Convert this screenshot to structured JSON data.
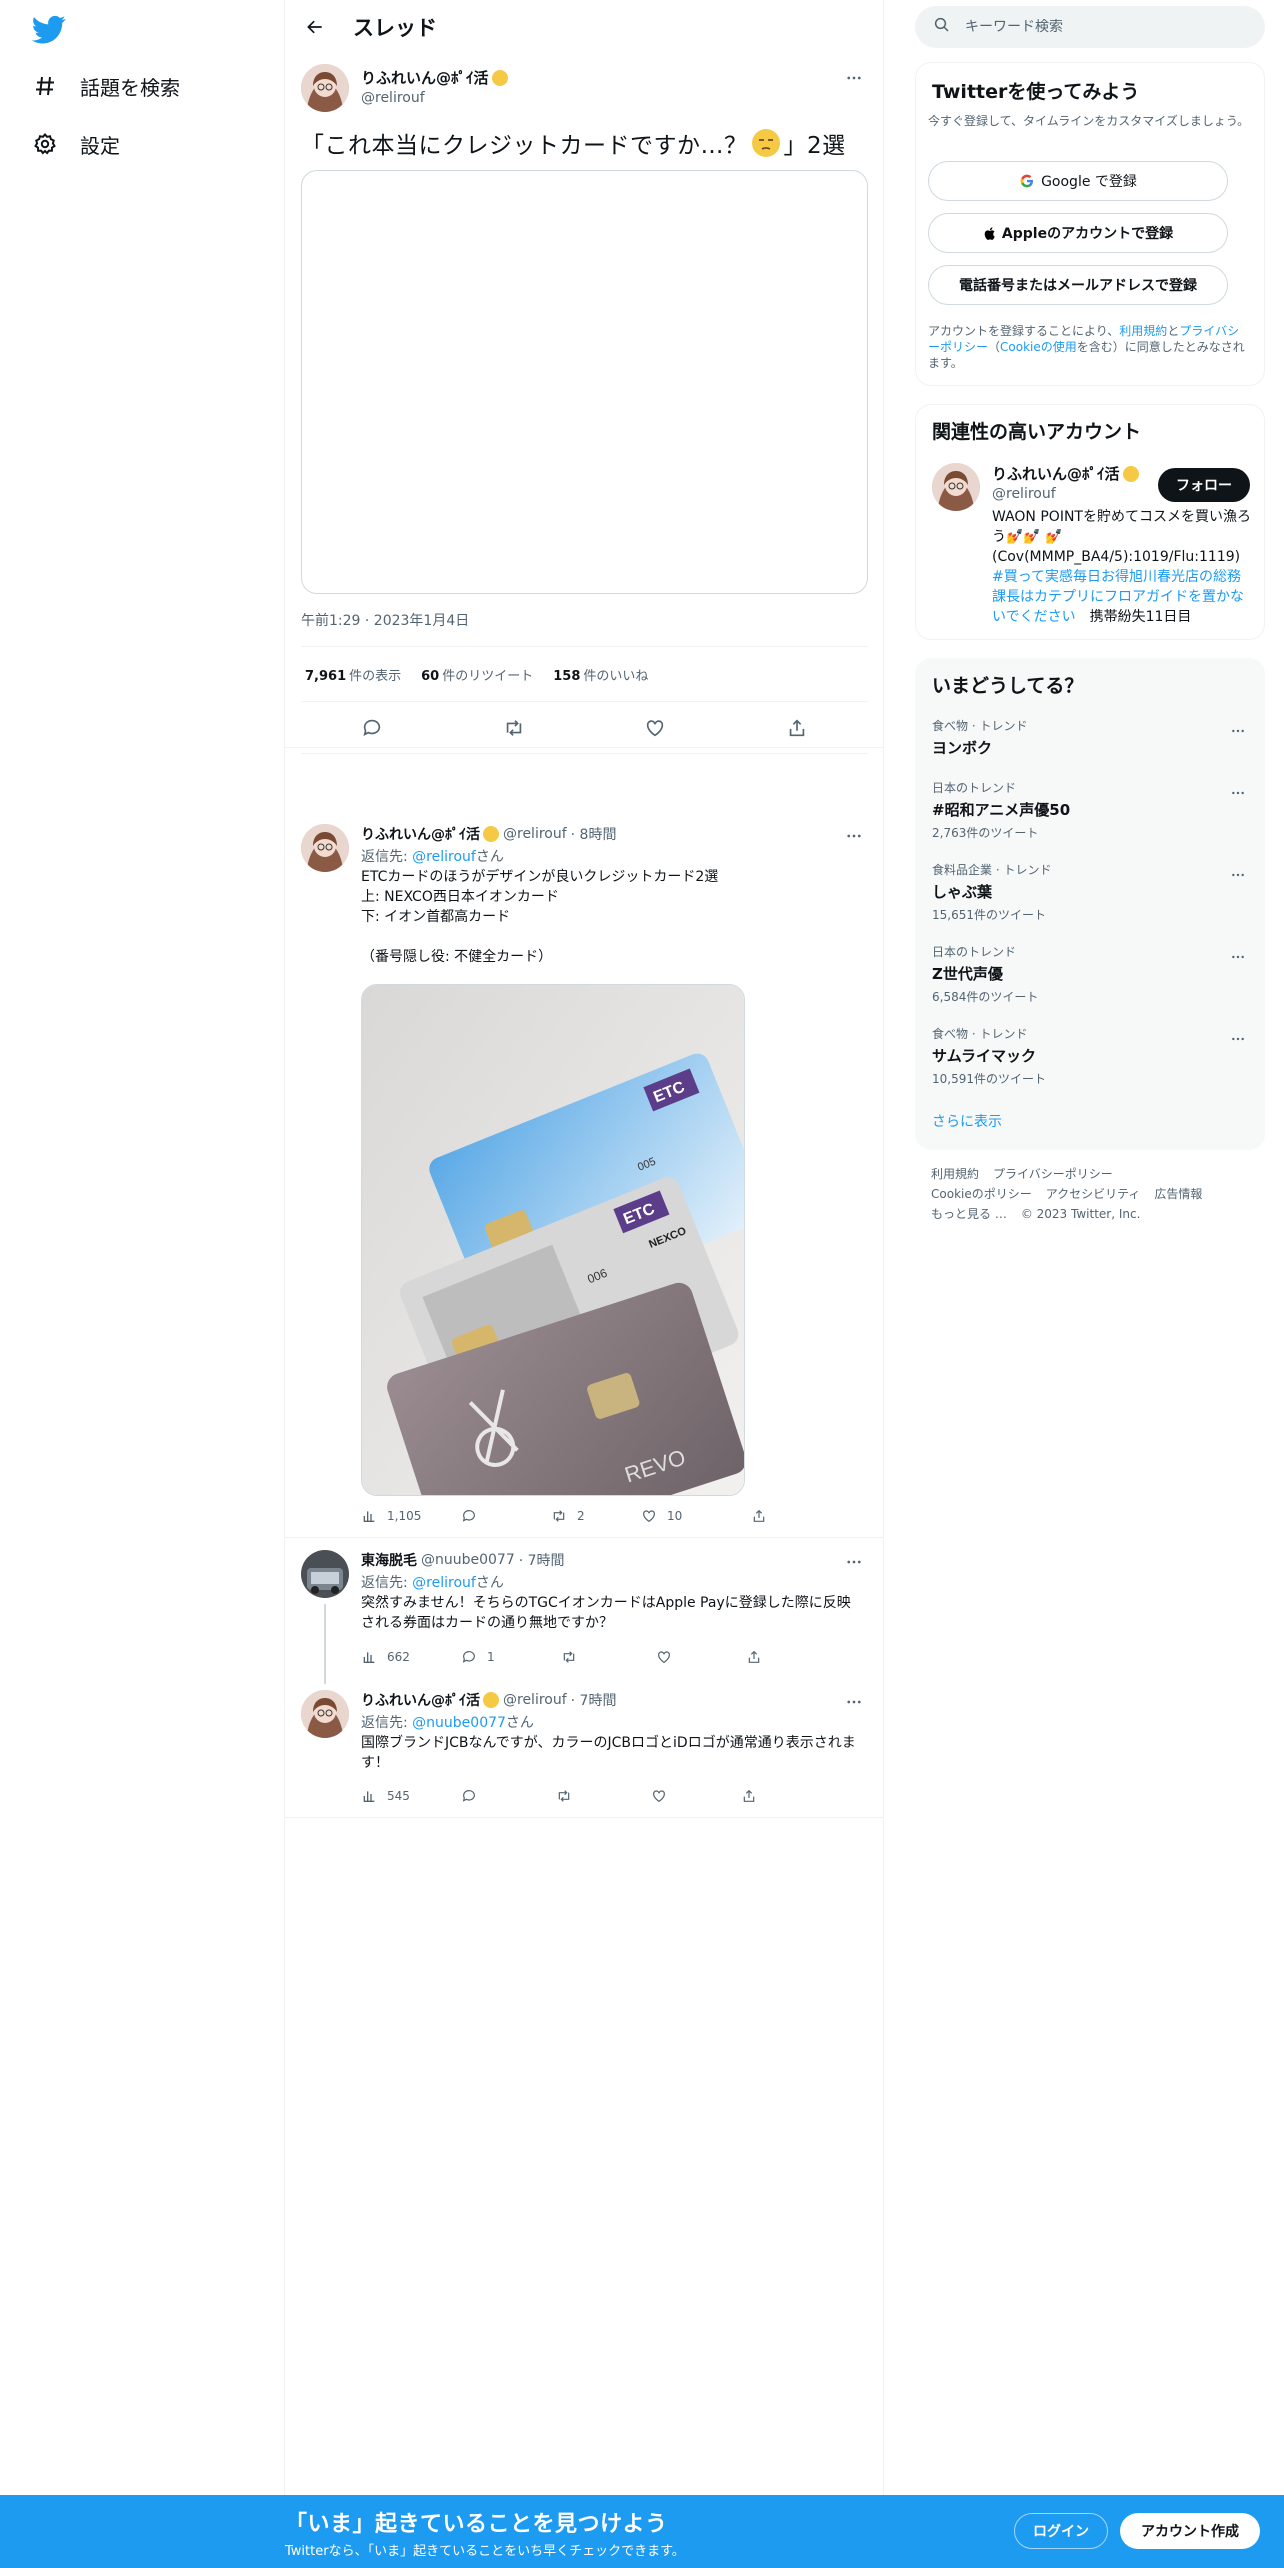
{
  "nav": {
    "items": [
      {
        "label": "話題を検索",
        "icon": "hashtag-icon"
      },
      {
        "label": "設定",
        "icon": "gear-icon"
      }
    ]
  },
  "header": {
    "title": "スレッド"
  },
  "main_tweet": {
    "name": "りふれいん@ﾎﾟｲ活",
    "handle": "@relirouf",
    "text_before": "「これ本当にクレジットカードですか…？",
    "text_after": "」2選",
    "time": "午前1:29 · 2023年1月4日",
    "stats": [
      {
        "value": "7,961",
        "label": "件の表示"
      },
      {
        "value": "60",
        "label": "件のリツイート"
      },
      {
        "value": "158",
        "label": "件のいいね"
      }
    ]
  },
  "replies": [
    {
      "name": "りふれいん@ﾎﾟｲ活",
      "handle": "@relirouf",
      "time": "· 8時間",
      "reply_prefix": "返信先: ",
      "reply_to": "@relirouf",
      "reply_suffix": "さん",
      "text": "ETCカードのほうがデザインが良いクレジットカード2選\n上: NEXCO西日本イオンカード\n下: イオン首都高カード\n\n（番号隠し役: 不健全カード）",
      "views": "1,105",
      "replies_count": "",
      "retweets": "2",
      "likes": "10"
    },
    {
      "name": "東海脱毛",
      "handle": "@nuube0077",
      "time": "· 7時間",
      "reply_prefix": "返信先: ",
      "reply_to": "@relirouf",
      "reply_suffix": "さん",
      "text": "突然すみません！そちらのTGCイオンカードはApple Payに登録した際に反映される券面はカードの通り無地ですか？",
      "views": "662",
      "replies_count": "1",
      "retweets": "",
      "likes": ""
    },
    {
      "name": "りふれいん@ﾎﾟｲ活",
      "handle": "@relirouf",
      "time": "· 7時間",
      "reply_prefix": "返信先: ",
      "reply_to": "@nuube0077",
      "reply_suffix": "さん",
      "text": "国際ブランドJCBなんですが、カラーのJCBロゴとiDロゴが通常通り表示されます！",
      "views": "545",
      "replies_count": "",
      "retweets": "",
      "likes": ""
    }
  ],
  "photo": {
    "card_labels": [
      "ETC",
      "ETC",
      "NEXCO",
      "005",
      "006",
      "REVO"
    ]
  },
  "search": {
    "placeholder": "キーワード検索"
  },
  "signup_panel": {
    "title": "Twitterを使ってみよう",
    "subtitle": "今すぐ登録して、タイムラインをカスタマイズしましょう。",
    "google": "Google で登録",
    "apple": "Appleのアカウントで登録",
    "phone": "電話番号またはメールアドレスで登録",
    "legal_1": "アカウントを登録することにより、",
    "legal_terms": "利用規約",
    "legal_2": "と",
    "legal_privacy": "プライバシーポリシー",
    "legal_3": "（",
    "legal_cookie": "Cookieの使用",
    "legal_4": "を含む）に同意したとみなされます。"
  },
  "related": {
    "title": "関連性の高いアカウント",
    "name": "りふれいん@ﾎﾟｲ活",
    "handle": "@relirouf",
    "follow": "フォロー",
    "bio_1": "WAON POINTを貯めてコスメを買い漁ろう💅💅 💅(Cov(MMMP_BA4/5):1019/Flu:1119) ",
    "bio_link": "#買って実感毎日お得旭川春光店の総務課長はカテプリにフロアガイドを置かないでください",
    "bio_2": "　携帯紛失11日目"
  },
  "trends": {
    "title": "いまどうしてる？",
    "items": [
      {
        "category": "食べ物 · トレンド",
        "name": "ヨンボク",
        "count": ""
      },
      {
        "category": "日本のトレンド",
        "name": "#昭和アニメ声優50",
        "count": "2,763件のツイート"
      },
      {
        "category": "食料品企業 · トレンド",
        "name": "しゃぶ葉",
        "count": "15,651件のツイート"
      },
      {
        "category": "日本のトレンド",
        "name": "Z世代声優",
        "count": "6,584件のツイート"
      },
      {
        "category": "食べ物 · トレンド",
        "name": "サムライマック",
        "count": "10,591件のツイート"
      }
    ],
    "show_more": "さらに表示"
  },
  "footer": {
    "line1": [
      "利用規約",
      "プライバシーポリシー"
    ],
    "line2": [
      "Cookieのポリシー",
      "アクセシビリティ",
      "広告情報"
    ],
    "line3": [
      "もっと見る …",
      "© 2023 Twitter, Inc."
    ]
  },
  "bottombar": {
    "title": "「いま」起きていることを見つけよう",
    "subtitle": "Twitterなら、「いま」起きていることをいち早くチェックできます。",
    "login": "ログイン",
    "signup": "アカウント作成"
  },
  "colors": {
    "accent": "#1d9bf0",
    "text": "#0f1419",
    "secondary": "#536471",
    "border": "#eff3f4"
  }
}
